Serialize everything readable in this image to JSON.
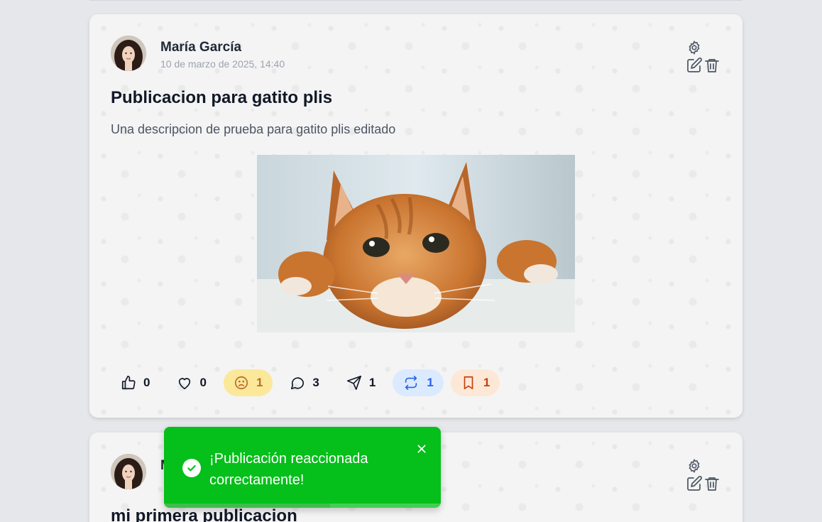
{
  "colors": {
    "toast_bg": "#05bf1a",
    "repost_accent": "#2563eb",
    "bookmark_accent": "#c2410c",
    "sad_accent": "#b45309"
  },
  "posts": [
    {
      "author": "María García",
      "date": "10 de marzo de 2025, 14:40",
      "title": "Publicacion para gatito plis",
      "description": "Una descripcion de prueba para gatito plis editado",
      "image_icon": "cat-photo",
      "reactions": {
        "like": "0",
        "love": "0",
        "sad": "1",
        "comments": "3",
        "shares": "1",
        "reposts": "1",
        "saves": "1"
      }
    },
    {
      "author": "M",
      "title": "mi primera publicacion"
    }
  ],
  "toast": {
    "message": "¡Publicación reaccionada correctamente!",
    "progress": 0.6
  }
}
